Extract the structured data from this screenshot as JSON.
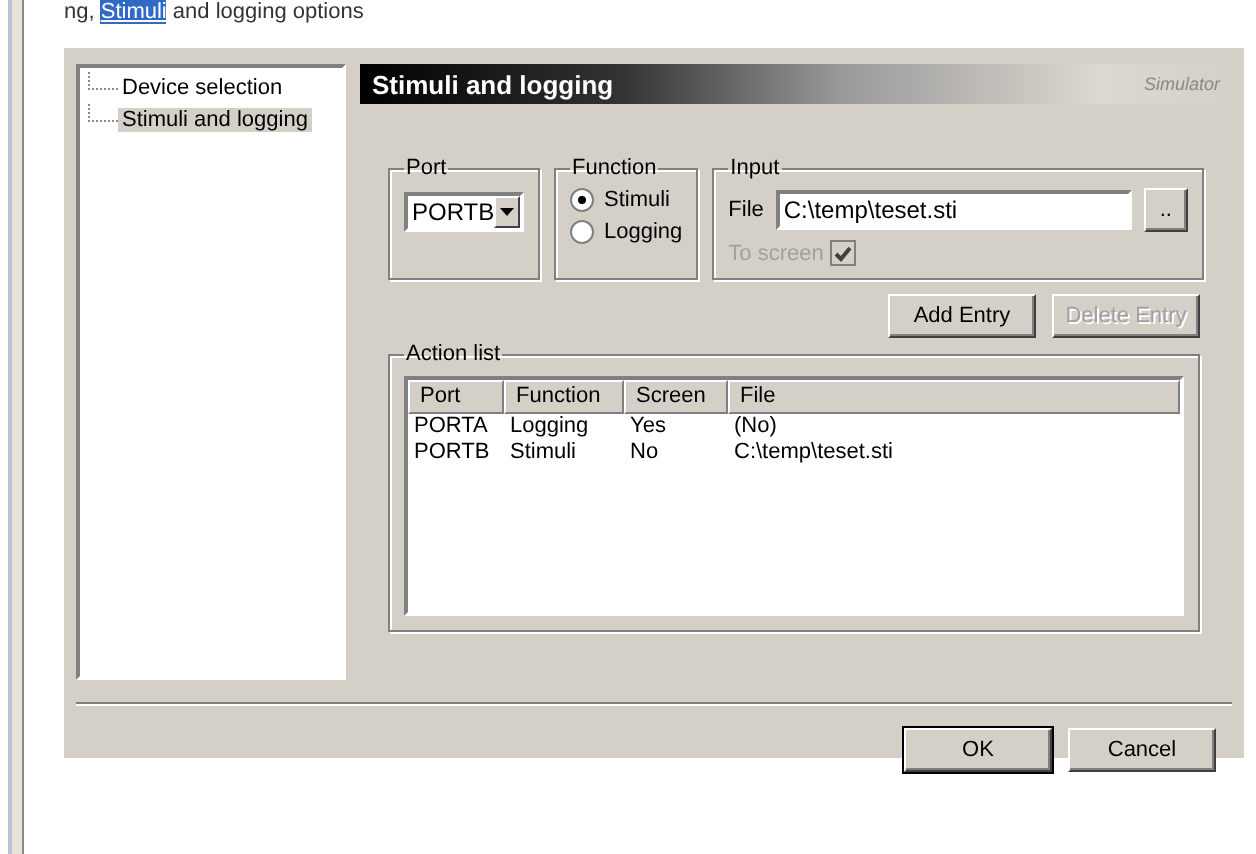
{
  "caption": {
    "prefix": "ng, ",
    "link": "Stimuli",
    "suffix": " and logging options"
  },
  "tree": [
    {
      "label": "Device selection",
      "selected": false
    },
    {
      "label": "Stimuli and logging",
      "selected": true
    }
  ],
  "header": {
    "title": "Stimuli and logging",
    "badge": "Simulator"
  },
  "port": {
    "legend": "Port",
    "value": "PORTB"
  },
  "function": {
    "legend": "Function",
    "options": [
      {
        "label": "Stimuli",
        "selected": true
      },
      {
        "label": "Logging",
        "selected": false
      }
    ]
  },
  "input": {
    "legend": "Input",
    "file_label": "File",
    "file_value": "C:\\temp\\teset.sti",
    "browse": "..",
    "to_screen": {
      "label": "To screen",
      "checked": true,
      "disabled": true
    }
  },
  "entry_buttons": [
    {
      "label": "Add Entry",
      "disabled": false
    },
    {
      "label": "Delete Entry",
      "disabled": true
    }
  ],
  "action_list": {
    "legend": "Action list",
    "columns": [
      "Port",
      "Function",
      "Screen",
      "File"
    ],
    "rows": [
      [
        "PORTA",
        "Logging",
        "Yes",
        "(No)"
      ],
      [
        "PORTB",
        "Stimuli",
        "No",
        "C:\\temp\\teset.sti"
      ]
    ]
  },
  "buttons": [
    {
      "label": "OK",
      "default": true
    },
    {
      "label": "Cancel",
      "default": false
    }
  ]
}
